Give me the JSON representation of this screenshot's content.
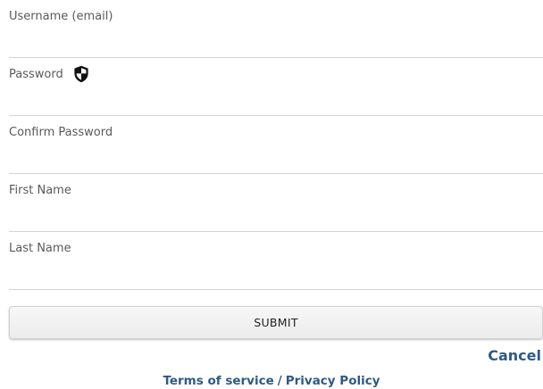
{
  "form": {
    "fields": [
      {
        "label": "Username (email)",
        "value": ""
      },
      {
        "label": "Password",
        "value": ""
      },
      {
        "label": "Confirm Password",
        "value": ""
      },
      {
        "label": "First Name",
        "value": ""
      },
      {
        "label": "Last Name",
        "value": ""
      }
    ],
    "submit_label": "SUBMIT",
    "cancel_label": "Cancel"
  },
  "footer": {
    "terms_label": "Terms of service",
    "separator": "/",
    "privacy_label": "Privacy Policy"
  },
  "icons": {
    "password_hint": "shield-icon"
  },
  "colors": {
    "link": "#2e5a86",
    "label": "#5a5a5a",
    "divider": "#d4d4d4"
  }
}
